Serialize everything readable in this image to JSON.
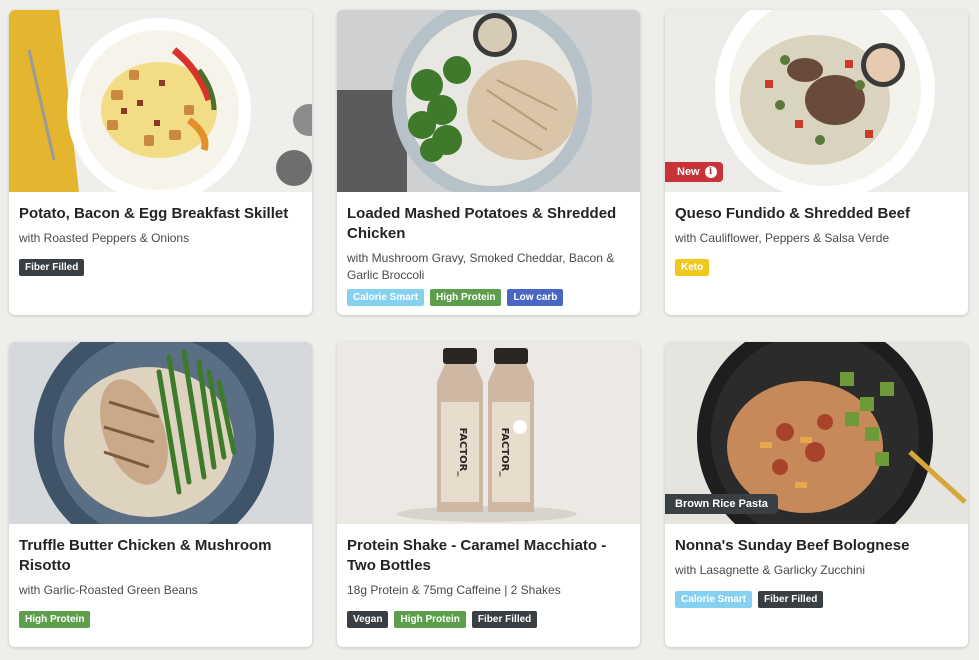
{
  "meals": [
    {
      "title": "Potato, Bacon & Egg Breakfast Skillet",
      "subtitle": "with Roasted Peppers & Onions",
      "tags": [
        "Fiber Filled"
      ]
    },
    {
      "title": "Loaded Mashed Potatoes & Shredded Chicken",
      "subtitle": "with Mushroom Gravy, Smoked Cheddar, Bacon & Garlic Broccoli",
      "tags": [
        "Calorie Smart",
        "High Protein",
        "Low carb"
      ]
    },
    {
      "title": "Queso Fundido & Shredded Beef",
      "subtitle": "with Cauliflower, Peppers & Salsa Verde",
      "badge": "New",
      "tags": [
        "Keto"
      ]
    },
    {
      "title": "Truffle Butter Chicken & Mushroom Risotto",
      "subtitle": "with Garlic-Roasted Green Beans",
      "tags": [
        "High Protein"
      ]
    },
    {
      "title": "Protein Shake - Caramel Macchiato - Two Bottles",
      "subtitle": "18g Protein & 75mg Caffeine | 2 Shakes",
      "bottle_label": "FACTOR_",
      "tags": [
        "Vegan",
        "High Protein",
        "Fiber Filled"
      ]
    },
    {
      "title": "Nonna's Sunday Beef Bolognese",
      "subtitle": "with Lasagnette & Garlicky Zucchini",
      "badge": "Brown Rice Pasta",
      "tags": [
        "Calorie Smart",
        "Fiber Filled"
      ]
    }
  ],
  "colors": {
    "tag_dark": "#3a3f44",
    "tag_green": "#5c9e4c",
    "tag_blue": "#4a66c4",
    "tag_light": "#86d0f0",
    "tag_yellow": "#f0c81e",
    "badge_red": "#c8323a"
  }
}
